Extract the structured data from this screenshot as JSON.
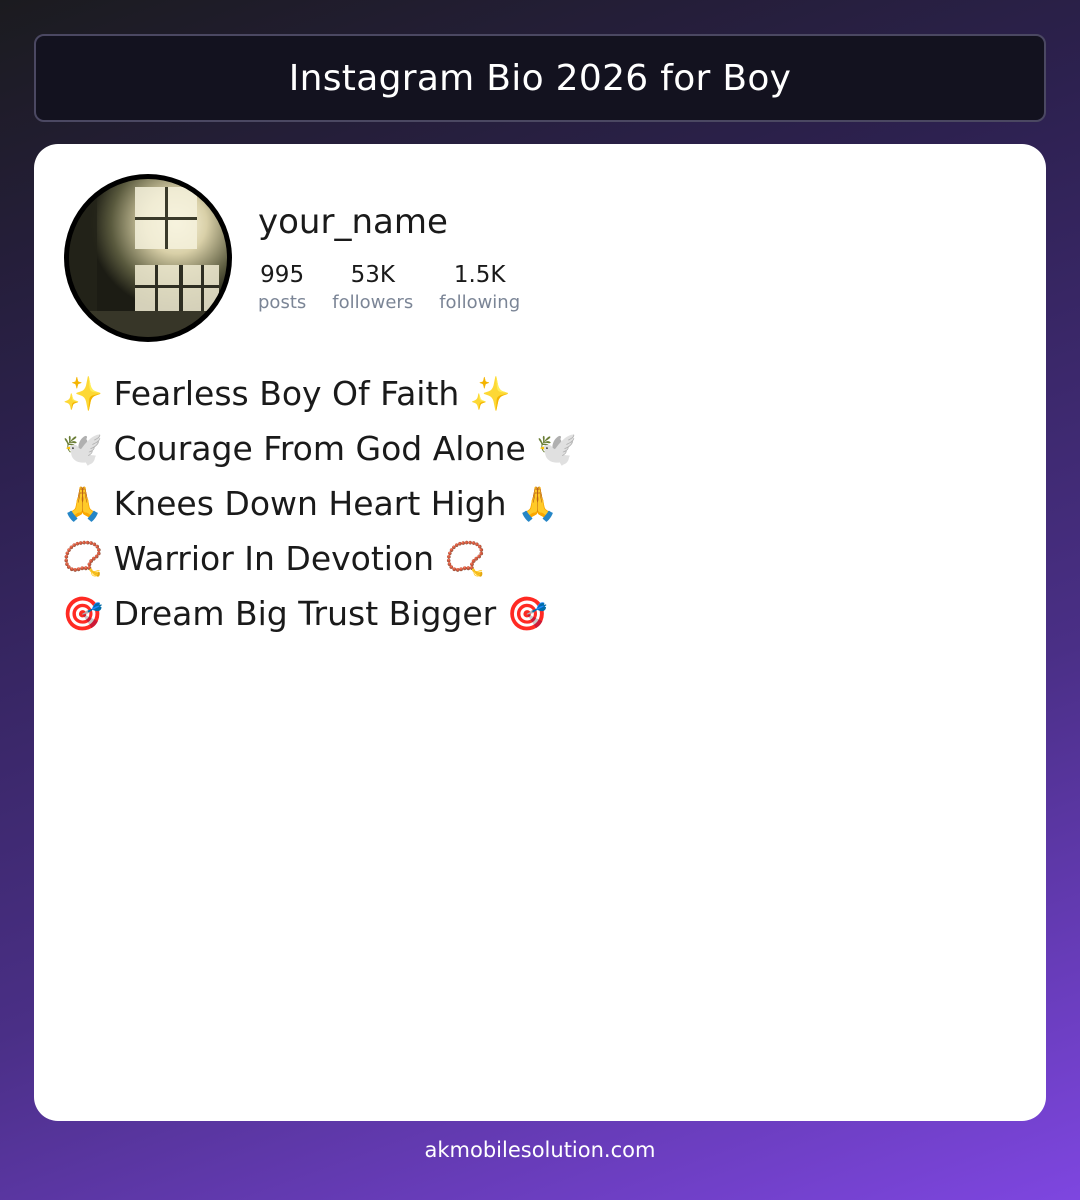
{
  "header": {
    "title": "Instagram Bio 2026 for Boy"
  },
  "profile": {
    "username": "your_name",
    "avatar_icon": "profile-photo-window-light",
    "stats": [
      {
        "value": "995",
        "label": "posts"
      },
      {
        "value": "53K",
        "label": "followers"
      },
      {
        "value": "1.5K",
        "label": "following"
      }
    ]
  },
  "bio": {
    "lines": [
      "✨ Fearless Boy Of Faith ✨",
      "🕊️ Courage From God Alone 🕊️",
      "🙏 Knees Down Heart High 🙏",
      "📿 Warrior In Devotion 📿",
      "🎯 Dream Big Trust Bigger 🎯"
    ]
  },
  "footer": {
    "site": "akmobilesolution.com"
  },
  "colors": {
    "card_bg": "#ffffff",
    "title_bar_bg": "#13121f",
    "stat_label": "#7b8596",
    "gradient_start": "#1b1b1f",
    "gradient_end": "#7e46e0"
  }
}
